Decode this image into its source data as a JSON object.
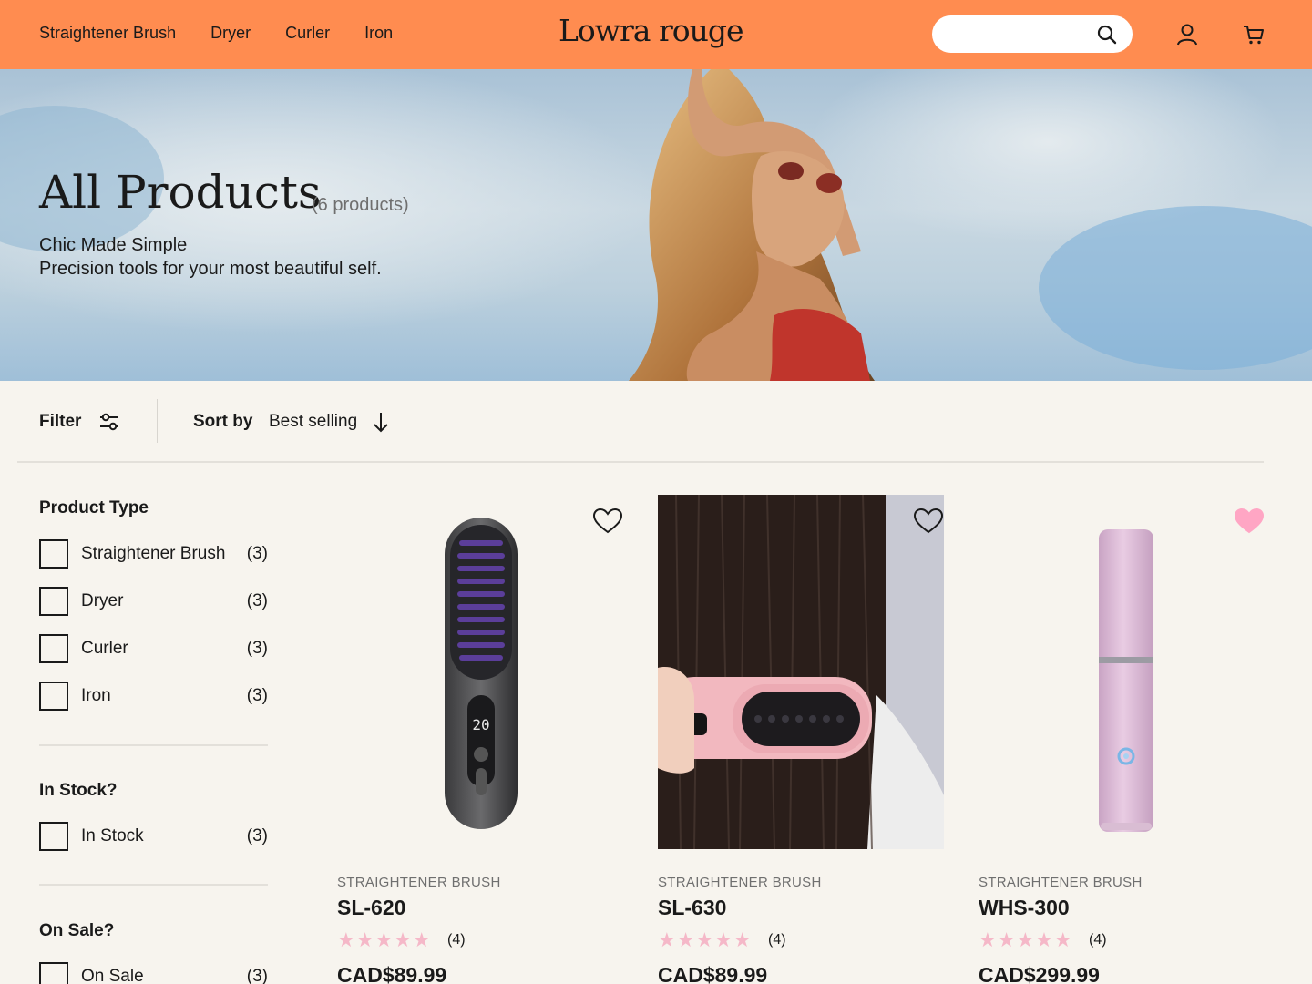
{
  "header": {
    "nav": [
      "Straightener Brush",
      "Dryer",
      "Curler",
      "Iron"
    ],
    "logo": "Lowra rouge",
    "search": {
      "placeholder": "",
      "value": ""
    }
  },
  "hero": {
    "title": "All Products",
    "count": "(6 products)",
    "subtitle_line1": "Chic Made Simple",
    "subtitle_line2": "Precision tools for your most beautiful self."
  },
  "toolbar": {
    "filter_label": "Filter",
    "sort_label": "Sort by",
    "sort_value": "Best selling"
  },
  "facets": [
    {
      "title": "Product Type",
      "options": [
        {
          "label": "Straightener Brush",
          "count": "(3)"
        },
        {
          "label": "Dryer",
          "count": "(3)"
        },
        {
          "label": "Curler",
          "count": "(3)"
        },
        {
          "label": "Iron",
          "count": "(3)"
        }
      ]
    },
    {
      "title": "In Stock?",
      "options": [
        {
          "label": "In Stock",
          "count": "(3)"
        }
      ]
    },
    {
      "title": "On Sale?",
      "options": [
        {
          "label": "On Sale",
          "count": "(3)"
        }
      ]
    }
  ],
  "products": [
    {
      "type": "STRAIGHTENER BRUSH",
      "name": "SL-620",
      "stars": "★★★★★",
      "reviews": "(4)",
      "price": "CAD$89.99",
      "favorited": false,
      "image": "black-brush-product"
    },
    {
      "type": "STRAIGHTENER BRUSH",
      "name": "SL-630",
      "stars": "★★★★★",
      "reviews": "(4)",
      "price": "CAD$89.99",
      "favorited": false,
      "image": "pink-brush-in-hair-photo"
    },
    {
      "type": "STRAIGHTENER BRUSH",
      "name": "WHS-300",
      "stars": "★★★★★",
      "reviews": "(4)",
      "price": "CAD$299.99",
      "favorited": true,
      "image": "pink-cylinder-product"
    }
  ],
  "colors": {
    "header_bg": "#ff8c50",
    "page_bg": "#f7f4ee",
    "star": "#f5b8c8",
    "heart_active": "#ffa6c4"
  }
}
